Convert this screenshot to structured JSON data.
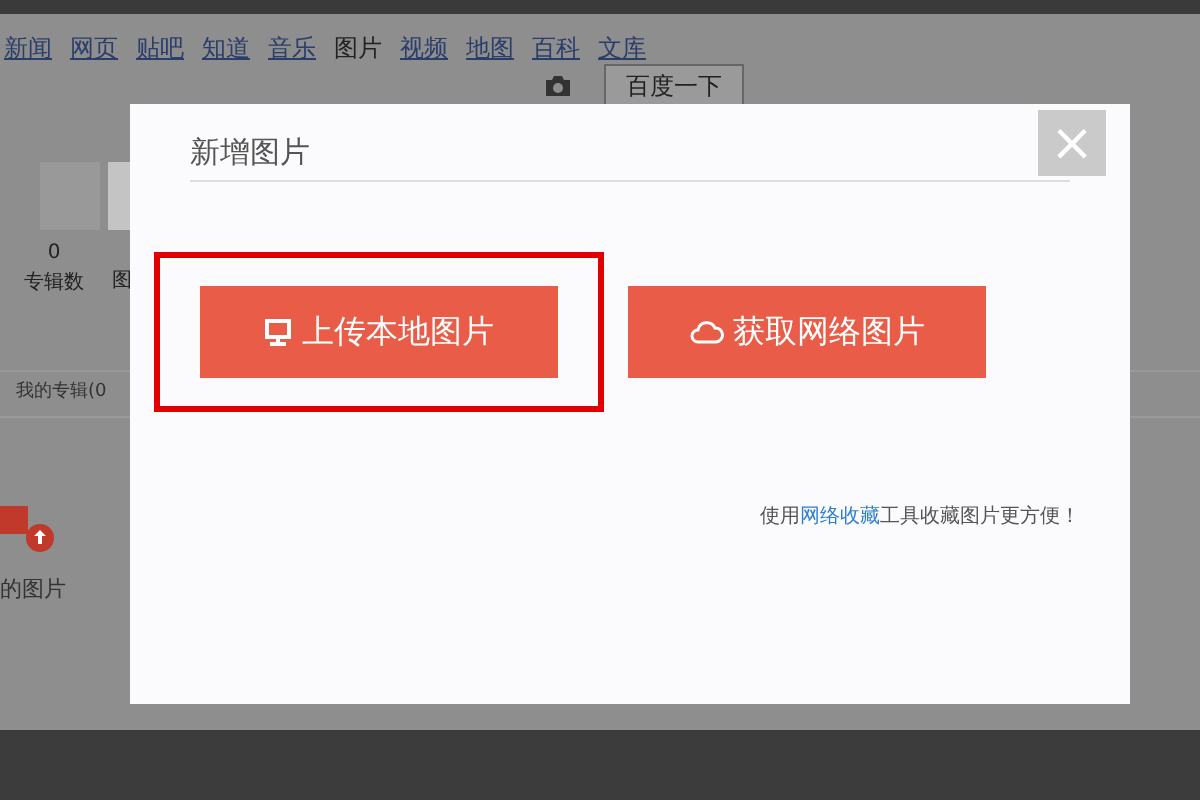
{
  "background_page": {
    "nav_links": [
      {
        "label": "新闻",
        "selected": false
      },
      {
        "label": "网页",
        "selected": false
      },
      {
        "label": "贴吧",
        "selected": false
      },
      {
        "label": "知道",
        "selected": false
      },
      {
        "label": "音乐",
        "selected": false
      },
      {
        "label": "图片",
        "selected": true
      },
      {
        "label": "视频",
        "selected": false
      },
      {
        "label": "地图",
        "selected": false
      },
      {
        "label": "百科",
        "selected": false
      },
      {
        "label": "文库",
        "selected": false
      }
    ],
    "search_button": "百度一下",
    "stat_value": "0",
    "stat_label": "专辑数",
    "stat_label_2": "图",
    "tab": "我的专辑(0",
    "item_caption": "的图片"
  },
  "dialog": {
    "title": "新增图片",
    "close": "×",
    "buttons": [
      {
        "label": "上传本地图片",
        "kind": "upload",
        "highlighted": true
      },
      {
        "label": "获取网络图片",
        "kind": "web",
        "highlighted": false
      }
    ],
    "hint_before": "使用",
    "hint_link": "网络收藏",
    "hint_after": "工具收藏图片更方便！"
  }
}
